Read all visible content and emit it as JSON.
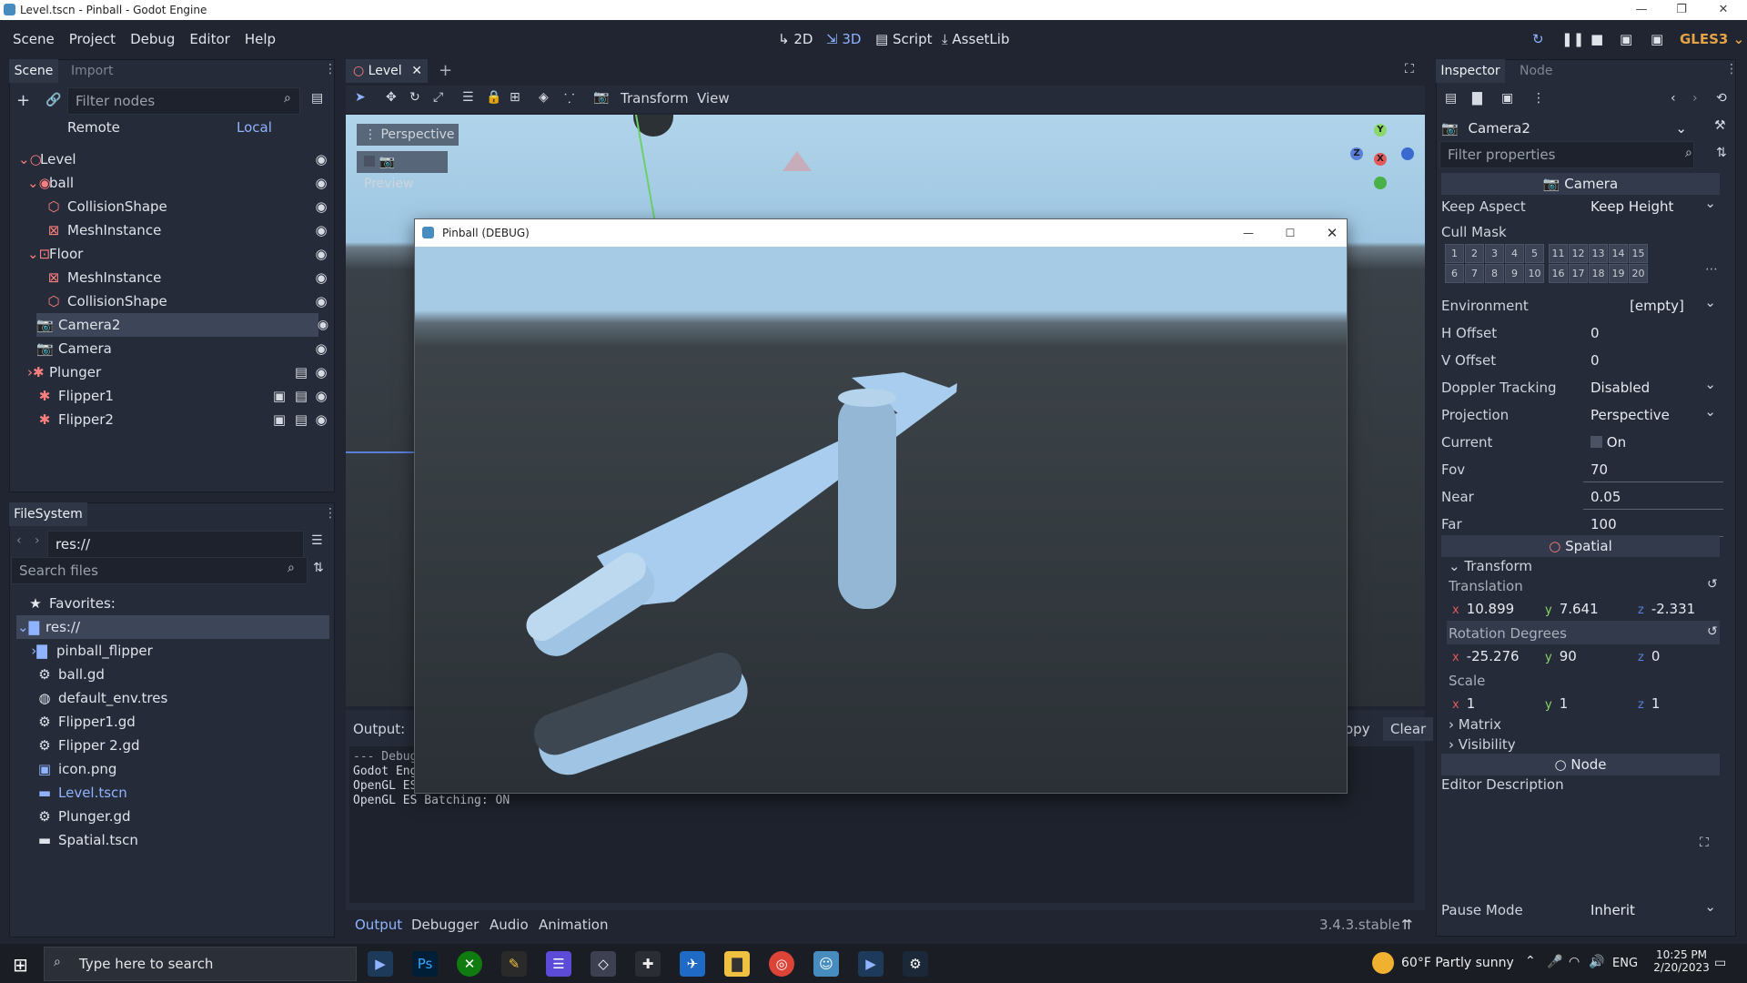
{
  "window": {
    "title": "Level.tscn - Pinball - Godot Engine"
  },
  "menu": [
    "Scene",
    "Project",
    "Debug",
    "Editor",
    "Help"
  ],
  "workspaces": {
    "w2d": "2D",
    "w3d": "3D",
    "script": "Script",
    "assetlib": "AssetLib"
  },
  "renderer": "GLES3",
  "scene_dock": {
    "tabs": [
      "Scene",
      "Import"
    ],
    "filter_placeholder": "Filter nodes",
    "remote": "Remote",
    "local": "Local",
    "nodes": [
      {
        "name": "Level"
      },
      {
        "name": "ball"
      },
      {
        "name": "CollisionShape"
      },
      {
        "name": "MeshInstance"
      },
      {
        "name": "Floor"
      },
      {
        "name": "MeshInstance"
      },
      {
        "name": "CollisionShape"
      },
      {
        "name": "Camera2"
      },
      {
        "name": "Camera"
      },
      {
        "name": "Plunger"
      },
      {
        "name": "Flipper1"
      },
      {
        "name": "Flipper2"
      }
    ]
  },
  "filesystem": {
    "tab": "FileSystem",
    "path": "res://",
    "search_placeholder": "Search files",
    "favorites": "Favorites:",
    "root": "res://",
    "items": [
      {
        "name": "pinball_flipper"
      },
      {
        "name": "ball.gd"
      },
      {
        "name": "default_env.tres"
      },
      {
        "name": "Flipper1.gd"
      },
      {
        "name": "Flipper 2.gd"
      },
      {
        "name": "icon.png"
      },
      {
        "name": "Level.tscn"
      },
      {
        "name": "Plunger.gd"
      },
      {
        "name": "Spatial.tscn"
      }
    ]
  },
  "editor": {
    "tab": "Level",
    "toolbar": {
      "transform": "Transform",
      "view": "View"
    },
    "perspective": "Perspective",
    "preview": "Preview",
    "gizmo": {
      "y": "Y",
      "z": "Z",
      "x": "X"
    }
  },
  "game_window": {
    "title": "Pinball (DEBUG)"
  },
  "output": {
    "label": "Output:",
    "copy": "opy",
    "clear": "Clear",
    "lines": [
      "--- Debug",
      "Godot Eng",
      "OpenGL ES",
      "OpenGL ES Batching: ON"
    ]
  },
  "bottom_tabs": [
    "Output",
    "Debugger",
    "Audio",
    "Animation"
  ],
  "version": "3.4.3.stable",
  "inspector": {
    "tabs": [
      "Inspector",
      "Node"
    ],
    "object": "Camera2",
    "filter_placeholder": "Filter properties",
    "camera_section": "Camera",
    "keep_aspect": {
      "label": "Keep Aspect",
      "value": "Keep Height"
    },
    "cull_mask": {
      "label": "Cull Mask",
      "row1": [
        "1",
        "2",
        "3",
        "4",
        "5",
        "11",
        "12",
        "13",
        "14",
        "15"
      ],
      "row2": [
        "6",
        "7",
        "8",
        "9",
        "10",
        "16",
        "17",
        "18",
        "19",
        "20"
      ]
    },
    "environment": {
      "label": "Environment",
      "value": "[empty]"
    },
    "h_offset": {
      "label": "H Offset",
      "value": "0"
    },
    "v_offset": {
      "label": "V Offset",
      "value": "0"
    },
    "doppler": {
      "label": "Doppler Tracking",
      "value": "Disabled"
    },
    "projection": {
      "label": "Projection",
      "value": "Perspective"
    },
    "current": {
      "label": "Current",
      "value": "On"
    },
    "fov": {
      "label": "Fov",
      "value": "70"
    },
    "near": {
      "label": "Near",
      "value": "0.05"
    },
    "far": {
      "label": "Far",
      "value": "100"
    },
    "spatial_section": "Spatial",
    "transform": "Transform",
    "translation": {
      "label": "Translation",
      "x": "10.899",
      "y": "7.641",
      "z": "-2.331"
    },
    "rotation": {
      "label": "Rotation Degrees",
      "x": "-25.276",
      "y": "90",
      "z": "0"
    },
    "scale": {
      "label": "Scale",
      "x": "1",
      "y": "1",
      "z": "1"
    },
    "matrix": "Matrix",
    "visibility": "Visibility",
    "node_section": "Node",
    "editor_description": "Editor Description",
    "pause_mode": {
      "label": "Pause Mode",
      "value": "Inherit"
    },
    "axis": {
      "x": "x",
      "y": "y",
      "z": "z"
    }
  },
  "taskbar": {
    "search_placeholder": "Type here to search",
    "weather": "60°F  Partly sunny",
    "lang": "ENG",
    "time": "10:25 PM",
    "date": "2/20/2023"
  }
}
